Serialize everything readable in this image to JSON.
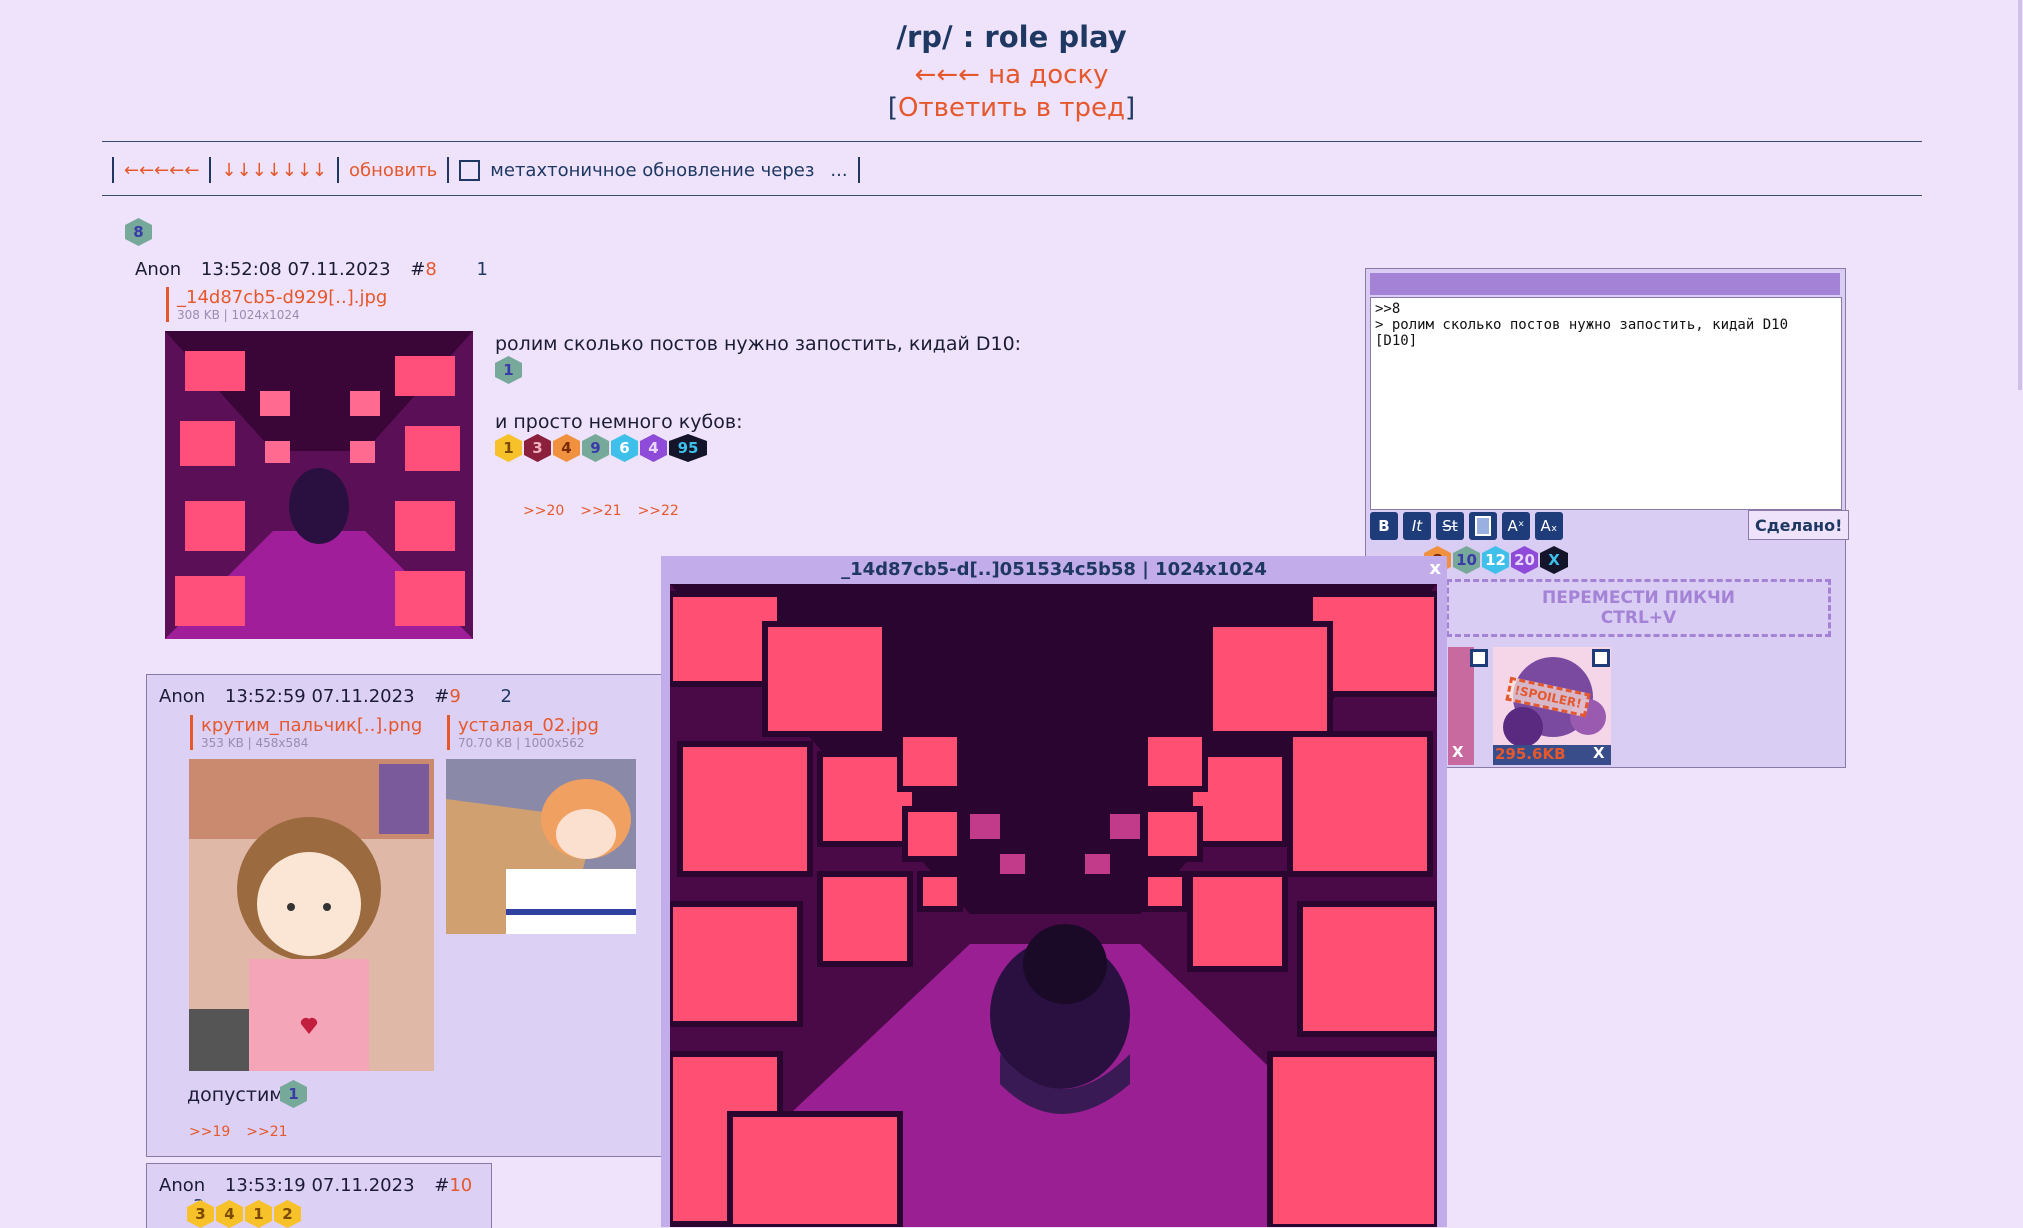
{
  "header": {
    "title": "/rp/ : role play",
    "back": "←←← на доску",
    "reply_prefix": "[",
    "reply": "Ответить в тред",
    "reply_suffix": "]"
  },
  "nav": {
    "back_arrows": "←←←←←",
    "down_arrows": "↓↓↓↓↓↓↓",
    "refresh": "обновить",
    "auto_update": "метахтоничное обновление через",
    "dots": "..."
  },
  "op": {
    "dice": "8",
    "name": "Anon",
    "datetime": "13:52:08 07.11.2023",
    "num_prefix": "#",
    "num": "8",
    "index": "1",
    "file_name": "_14d87cb5-d929[..].jpg",
    "file_info": "308 KB | 1024x1024",
    "text1": "ролим сколько постов нужно запостить, кидай D10:",
    "roll1": "1",
    "text2": "и просто немного кубов:",
    "rolls": [
      "1",
      "3",
      "4",
      "9",
      "6",
      "4",
      "95"
    ],
    "replies": [
      ">>20",
      ">>21",
      ">>22"
    ]
  },
  "post9": {
    "name": "Anon",
    "datetime": "13:52:59 07.11.2023",
    "num_prefix": "#",
    "num": "9",
    "index": "2",
    "file1_name": "крутим_пальчик[..].png",
    "file1_info": "353 KB | 458x584",
    "file2_name": "усталая_02.jpg",
    "file2_info": "70.70 KB | 1000x562",
    "text": "допустим:",
    "roll": "1",
    "replies": [
      ">>19",
      ">>21"
    ]
  },
  "post10": {
    "name": "Anon",
    "datetime": "13:53:19 07.11.2023",
    "num_prefix": "#",
    "num": "10",
    "index": "3",
    "rolls": [
      "3",
      "4",
      "1",
      "2"
    ]
  },
  "quick_reply": {
    "text": ">>8\n> ролим сколько постов нужно запостить, кидай D10\n[D10]",
    "tools": [
      "B",
      "It",
      "St",
      "",
      "Aˣ",
      "Aₓ"
    ],
    "done": "Сделано!",
    "dice_buttons": [
      "8",
      "10",
      "12",
      "20",
      "X"
    ],
    "drop_line1": "ПЕРЕМЕСТИ ПИКЧИ",
    "drop_line2": "CTRL+V",
    "spoiler": "!SPOILER!",
    "attach_size": "295.6KB",
    "remove": "X"
  },
  "viewer": {
    "title": "_14d87cb5-d[..]051534c5b58 | 1024x1024",
    "close": "x"
  }
}
